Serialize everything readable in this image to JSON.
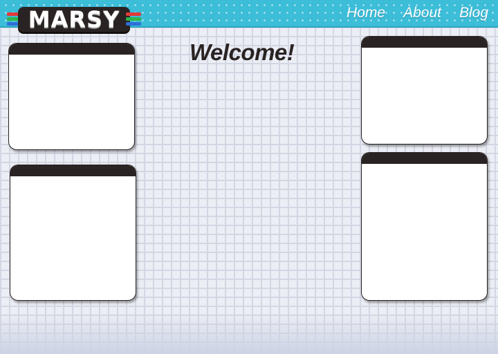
{
  "brand": {
    "logo_text": "MARSY",
    "stripe_colors": [
      "#e23a3a",
      "#2fb54a",
      "#2f6fd8"
    ]
  },
  "nav": {
    "items": [
      {
        "label": "Home"
      },
      {
        "label": "About"
      },
      {
        "label": "Blog"
      }
    ]
  },
  "main": {
    "heading": "Welcome!"
  },
  "colors": {
    "header": "#3cbdd8",
    "panel_bar": "#2a2323",
    "background": "#eceef5"
  }
}
